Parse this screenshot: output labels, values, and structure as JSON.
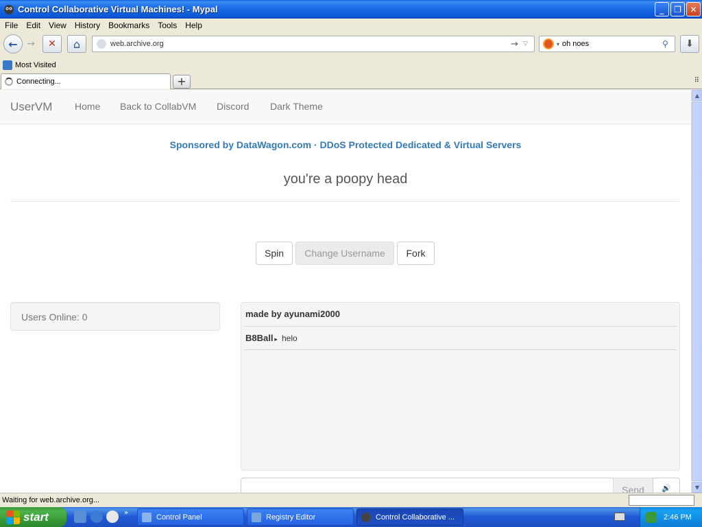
{
  "window": {
    "title": "Control Collaborative Virtual Machines! - Mypal",
    "buttons": {
      "minimize": "_",
      "maximize": "❐",
      "close": "✕"
    }
  },
  "menu": [
    "File",
    "Edit",
    "View",
    "History",
    "Bookmarks",
    "Tools",
    "Help"
  ],
  "toolbar": {
    "back_icon": "←",
    "forward_icon": "→",
    "stop_icon": "✕",
    "home_icon": "⌂",
    "url": "web.archive.org",
    "go_icon": "→",
    "url_dropdown_icon": "▽",
    "search_value": "oh noes",
    "search_engine_dropdown": "▾",
    "search_icon": "⚲",
    "download_icon": "⬇"
  },
  "bookmarks": {
    "most_visited": "Most Visited"
  },
  "tabs": {
    "active_label": "Connecting...",
    "new_tab": "+",
    "list_icon": "⠿"
  },
  "site": {
    "brand": "UserVM",
    "nav": [
      "Home",
      "Back to CollabVM",
      "Discord",
      "Dark Theme"
    ],
    "sponsor": "Sponsored by DataWagon.com · DDoS Protected Dedicated & Virtual Servers",
    "motd": "you're a poopy head",
    "buttons": {
      "spin": "Spin",
      "change_username": "Change Username",
      "fork": "Fork"
    },
    "users_online": "Users Online: 0",
    "chat": {
      "header": "made by ayunami2000",
      "messages": [
        {
          "user": "B8Ball",
          "arrow": "▸",
          "text": "helo"
        }
      ],
      "send_label": "Send",
      "volume_icon": "🔊"
    }
  },
  "status": {
    "text": "Waiting for web.archive.org..."
  },
  "taskbar": {
    "start_label": "start",
    "tasks": [
      {
        "label": "Control Panel"
      },
      {
        "label": "Registry Editor"
      },
      {
        "label": "Control Collaborative ..."
      }
    ],
    "clock": "2:46 PM",
    "overflow_icon": "»"
  },
  "colors": {
    "title_bar": "#0b56d4",
    "link_blue": "#337ab7",
    "nav_gray": "#777777",
    "taskbar_blue": "#2157d7",
    "start_green": "#3c9a3c"
  }
}
